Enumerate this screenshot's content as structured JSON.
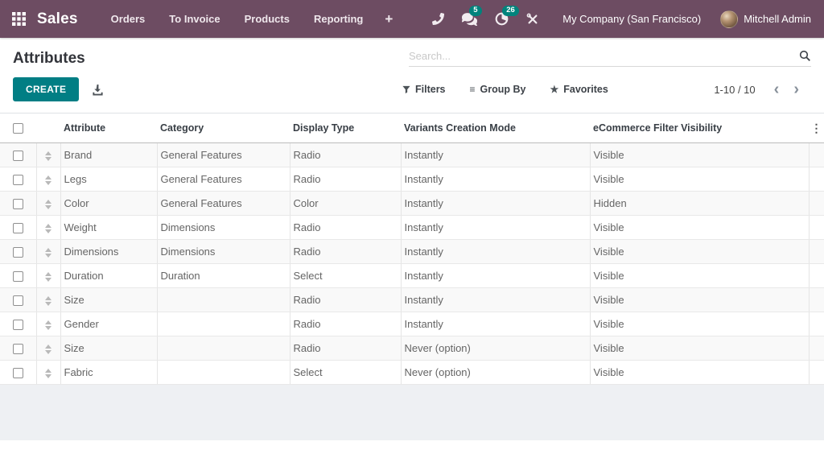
{
  "navbar": {
    "brand": "Sales",
    "menus": [
      {
        "label": "Orders"
      },
      {
        "label": "To Invoice"
      },
      {
        "label": "Products"
      },
      {
        "label": "Reporting"
      }
    ],
    "plus_label": "+",
    "systray": {
      "messages_count": "5",
      "activities_count": "26",
      "company": "My Company (San Francisco)",
      "user": "Mitchell Admin"
    }
  },
  "control_panel": {
    "title": "Attributes",
    "create_label": "CREATE",
    "search_placeholder": "Search...",
    "filters_label": "Filters",
    "group_by_label": "Group By",
    "favorites_label": "Favorites",
    "pager_value": "1-10 / 10"
  },
  "icons": {
    "group_by_glyph": "≡",
    "favorites_glyph": "★",
    "dots_glyph": "⋮",
    "pager_prev_glyph": "‹",
    "pager_next_glyph": "›"
  },
  "table": {
    "columns": [
      "Attribute",
      "Category",
      "Display Type",
      "Variants Creation Mode",
      "eCommerce Filter Visibility"
    ],
    "rows": [
      {
        "attribute": "Brand",
        "category": "General Features",
        "display_type": "Radio",
        "variants_mode": "Instantly",
        "visibility": "Visible"
      },
      {
        "attribute": "Legs",
        "category": "General Features",
        "display_type": "Radio",
        "variants_mode": "Instantly",
        "visibility": "Visible"
      },
      {
        "attribute": "Color",
        "category": "General Features",
        "display_type": "Color",
        "variants_mode": "Instantly",
        "visibility": "Hidden"
      },
      {
        "attribute": "Weight",
        "category": "Dimensions",
        "display_type": "Radio",
        "variants_mode": "Instantly",
        "visibility": "Visible"
      },
      {
        "attribute": "Dimensions",
        "category": "Dimensions",
        "display_type": "Radio",
        "variants_mode": "Instantly",
        "visibility": "Visible"
      },
      {
        "attribute": "Duration",
        "category": "Duration",
        "display_type": "Select",
        "variants_mode": "Instantly",
        "visibility": "Visible"
      },
      {
        "attribute": "Size",
        "category": "",
        "display_type": "Radio",
        "variants_mode": "Instantly",
        "visibility": "Visible"
      },
      {
        "attribute": "Gender",
        "category": "",
        "display_type": "Radio",
        "variants_mode": "Instantly",
        "visibility": "Visible"
      },
      {
        "attribute": "Size",
        "category": "",
        "display_type": "Radio",
        "variants_mode": "Never (option)",
        "visibility": "Visible"
      },
      {
        "attribute": "Fabric",
        "category": "",
        "display_type": "Select",
        "variants_mode": "Never (option)",
        "visibility": "Visible"
      }
    ]
  },
  "colors": {
    "navbar_bg": "#6d4c62",
    "primary_teal": "#017e84",
    "badge_teal": "#00837c",
    "row_stripe": "#f9f9f9",
    "bottom_bg": "#eef0f3"
  }
}
